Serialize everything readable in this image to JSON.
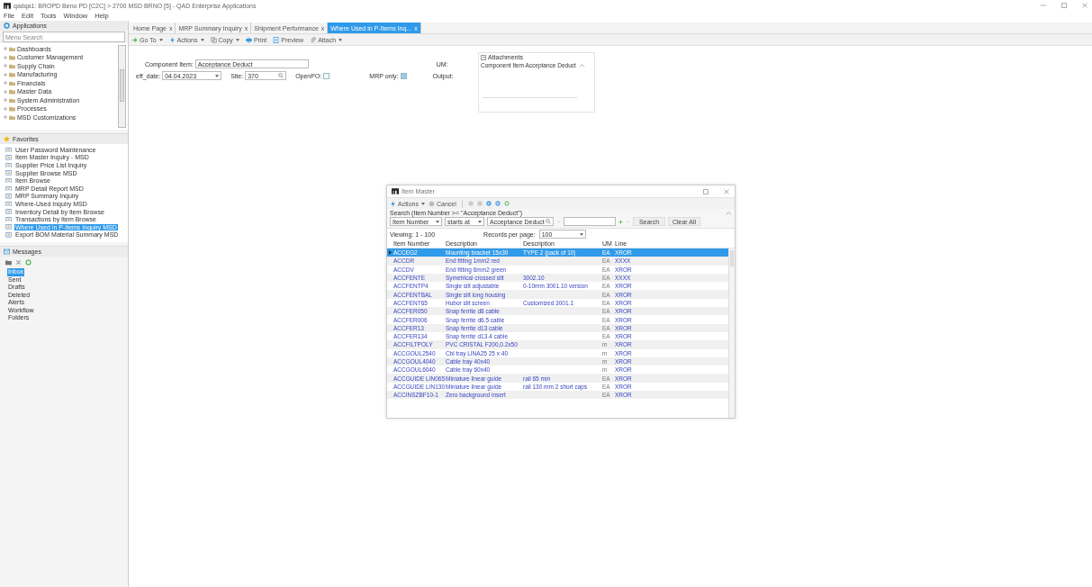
{
  "window": {
    "title": "qadqa1: BROPD Beno PD [C2C] > 2700 MSD BRNO [5] - QAD Enterprise Applications"
  },
  "menu": [
    "File",
    "Edit",
    "Tools",
    "Window",
    "Help"
  ],
  "sidebar": {
    "applications": {
      "title": "Applications",
      "search_placeholder": "Menu Search",
      "items": [
        {
          "label": "Dashboards"
        },
        {
          "label": "Customer Management"
        },
        {
          "label": "Supply Chain"
        },
        {
          "label": "Manufacturing"
        },
        {
          "label": "Financials"
        },
        {
          "label": "Master Data"
        },
        {
          "label": "System Administration"
        },
        {
          "label": "Processes"
        },
        {
          "label": "MSD Customizations"
        }
      ]
    },
    "favorites": {
      "title": "Favorites",
      "items": [
        {
          "label": "User Password Maintenance",
          "selected": false
        },
        {
          "label": "Item Master Inquiry - MSD",
          "selected": false
        },
        {
          "label": "Supplier Price List Inquiry",
          "selected": false
        },
        {
          "label": "Supplier Browse MSD",
          "selected": false
        },
        {
          "label": "Item Browse",
          "selected": false
        },
        {
          "label": "MRP Detail Report MSD",
          "selected": false
        },
        {
          "label": "MRP Summary Inquiry",
          "selected": false
        },
        {
          "label": "Where-Used Inquiry MSD",
          "selected": false
        },
        {
          "label": "Inventory Detail by Item Browse",
          "selected": false
        },
        {
          "label": "Transactions by Item Browse",
          "selected": false
        },
        {
          "label": "Where Used in P-Items Inquiry MSD",
          "selected": true
        },
        {
          "label": "Export BOM Material Summary MSD",
          "selected": false
        }
      ]
    },
    "messages": {
      "title": "Messages",
      "folders": [
        {
          "label": "Inbox",
          "selected": true
        },
        {
          "label": "Sent",
          "selected": false
        },
        {
          "label": "Drafts",
          "selected": false
        },
        {
          "label": "Deleted",
          "selected": false
        },
        {
          "label": "Alerts",
          "selected": false
        },
        {
          "label": "Workflow",
          "selected": false
        },
        {
          "label": "Folders",
          "selected": false
        }
      ]
    }
  },
  "tabs": [
    {
      "label": "Home Page",
      "selected": false,
      "close": "x"
    },
    {
      "label": "MRP Summary Inquiry",
      "selected": false,
      "close": "x"
    },
    {
      "label": "Shipment Performance",
      "selected": false,
      "close": "x"
    },
    {
      "label": "Where Used in P-Items Inq...",
      "selected": true,
      "close": "x"
    }
  ],
  "toolbar": [
    {
      "label": "Go To",
      "dropdown": true
    },
    {
      "label": "Actions",
      "dropdown": true
    },
    {
      "label": "Copy",
      "dropdown": true
    },
    {
      "label": "Print",
      "dropdown": false
    },
    {
      "label": "Preview",
      "dropdown": false
    },
    {
      "label": "Attach",
      "dropdown": true
    }
  ],
  "form": {
    "component_item": {
      "label": "Component Item:",
      "value": "Acceptance Deduct"
    },
    "um": {
      "label": "UM:"
    },
    "eff_date": {
      "label": "eff_date:",
      "value": "04.04.2023"
    },
    "site": {
      "label": "Site:",
      "value": "370"
    },
    "open_po": {
      "label": "OpenPO:",
      "checked": false
    },
    "mrp_only": {
      "label": "MRP only:",
      "checked": true
    },
    "output": {
      "label": "Output:"
    }
  },
  "attachments": {
    "title": "Attachments",
    "item": "Component Item Acceptance Deduct"
  },
  "dialog": {
    "title": "Item Master",
    "toolbar": [
      {
        "label": "Actions"
      },
      {
        "label": "Cancel"
      }
    ],
    "search_caption": "Search (Item Number >= \"Acceptance Deduct\")",
    "criteria": {
      "field": "Item Number",
      "operator": "starts at",
      "value": "Acceptance Deduct"
    },
    "search_button": "Search",
    "clear_button": "Clear All",
    "viewing": "Viewing: 1 - 100",
    "records_label": "Records per page:",
    "records_value": "100",
    "columns": [
      "Item Number",
      "Description",
      "Description",
      "UM",
      "Line"
    ],
    "rows": [
      {
        "selected": true,
        "cells": [
          "ACCEG2",
          "Mounting bracket 15x30",
          "TYPE 2 (pack of 10)",
          "EA",
          "XROR"
        ]
      },
      {
        "selected": false,
        "cells": [
          "ACCDR",
          "End fitting 1mm2 red",
          "",
          "EA",
          "XXXX"
        ]
      },
      {
        "selected": false,
        "cells": [
          "ACCDV",
          "End fitting 6mm2 green",
          "",
          "EA",
          "XROR"
        ]
      },
      {
        "selected": false,
        "cells": [
          "ACCFENTE",
          "Symetrical crossed slit",
          "3002.10",
          "EA",
          "XXXX"
        ]
      },
      {
        "selected": false,
        "cells": [
          "ACCFENTP4",
          "Single slit adjustable",
          "0-10mm 3001.10 version",
          "EA",
          "XROR"
        ]
      },
      {
        "selected": false,
        "cells": [
          "ACCFENTBAL",
          "Single slit long housing",
          "",
          "EA",
          "XROR"
        ]
      },
      {
        "selected": false,
        "cells": [
          "ACCFENT65",
          "Hubor slit screen",
          "Customized 3001.1",
          "EA",
          "XROR"
        ]
      },
      {
        "selected": false,
        "cells": [
          "ACCFER050",
          "Snap ferrite d8 cable",
          "",
          "EA",
          "XROR"
        ]
      },
      {
        "selected": false,
        "cells": [
          "ACCFER006",
          "Snap ferrite d6.5 cable",
          "",
          "EA",
          "XROR"
        ]
      },
      {
        "selected": false,
        "cells": [
          "ACCFER13",
          "Snap ferrite d13 cable",
          "",
          "EA",
          "XROR"
        ]
      },
      {
        "selected": false,
        "cells": [
          "ACCFER134",
          "Snap ferrite d13.4 cable",
          "",
          "EA",
          "XROR"
        ]
      },
      {
        "selected": false,
        "cells": [
          "ACCFILTPOLY",
          "PVC CRISTAL F200,0.2x50",
          "",
          "m",
          "XROR"
        ]
      },
      {
        "selected": false,
        "cells": [
          "ACCGOUL2540",
          "Cbl tray LINA25 25 x 40",
          "",
          "m",
          "XROR"
        ]
      },
      {
        "selected": false,
        "cells": [
          "ACCGOUL4040",
          "Cable tray 40x40",
          "",
          "m",
          "XROR"
        ]
      },
      {
        "selected": false,
        "cells": [
          "ACCGOUL6040",
          "Cable tray 60x40",
          "",
          "m",
          "XROR"
        ]
      },
      {
        "selected": false,
        "cells": [
          "ACCGUIDE LIN065",
          "Miniature linear guide",
          "rail 65 mm",
          "EA",
          "XROR"
        ]
      },
      {
        "selected": false,
        "cells": [
          "ACCGUIDE LIN130",
          "Miniature linear guide",
          "rail 130 mm 2 short caps",
          "EA",
          "XROR"
        ]
      },
      {
        "selected": false,
        "cells": [
          "ACCINSZBF10-1",
          "Zero background insert",
          "",
          "EA",
          "XROR"
        ]
      }
    ]
  }
}
